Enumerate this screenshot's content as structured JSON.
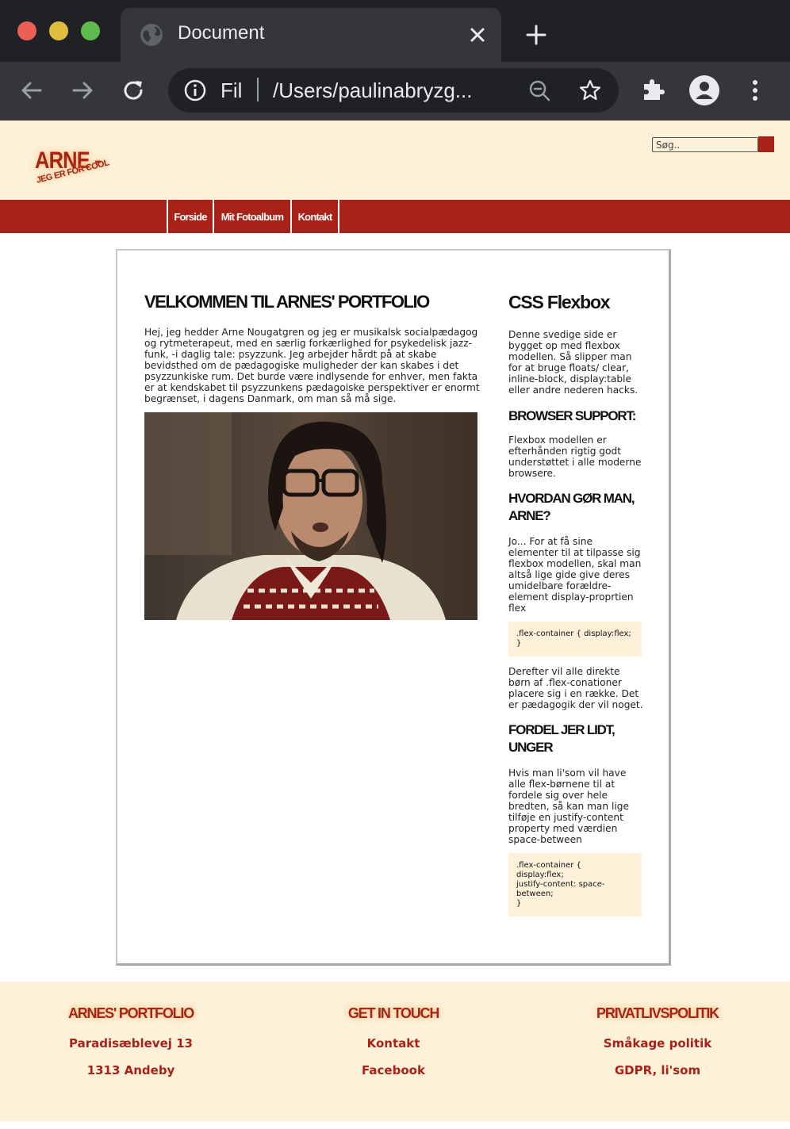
{
  "browser": {
    "tab_title": "Document",
    "omnibox_prefix": "Fil",
    "url": "/Users/paulinabryzg..."
  },
  "header": {
    "logo_main": "ARNE -",
    "logo_sub": "JEG ER FOR COOL",
    "search_placeholder": "Søg.."
  },
  "nav": {
    "items": [
      "Forside",
      "Mit Fotoalbum",
      "Kontakt"
    ]
  },
  "main": {
    "title": "VELKOMMEN TIL ARNES' PORTFOLIO",
    "text": "Hej, jeg hedder Arne Nougatgren og jeg er musikalsk socialpædagog og rytmeterapeut, med en særlig forkærlighed for psykedelisk jazz-funk, -i daglig tale: psyzzunk. Jeg arbejder hårdt på at skabe bevidsthed om de pædagogiske muligheder der kan skabes i det psyzzunkiske rum. Det burde være indlysende for enhver, men fakta er at kendskabet til psyzzunkens pædagoiske perspektiver er enormt begrænset, i dagens Danmark, om man så må sige."
  },
  "sidebar": {
    "h1": "CSS Flexbox",
    "p1": "Denne svedige side er bygget op med flexbox modellen. Så slipper man for at bruge floats/ clear, inline-block, display:table eller andre nederen hacks.",
    "h2": "BROWSER SUPPORT:",
    "p2": "Flexbox modellen er efterhånden rigtig godt understøttet i alle moderne browsere.",
    "h3": "HVORDAN GØR MAN, ARNE?",
    "p3": "Jo... For at få sine elementer til at tilpasse sig flexbox modellen, skal man altså lige gide give deres umidelbare forældre-element display-proprtien flex",
    "code1": ".flex-container { display:flex;\n}",
    "p4": "Derefter vil alle direkte børn af .flex-conationer placere sig i en række. Det er pædagogik der vil noget.",
    "h4": "FORDEL JER LIDT, UNGER",
    "p5": "Hvis man li'som vil have alle flex-børnene til at fordele sig over hele bredten, så kan man lige tilføje en justify-content property med værdien space-between",
    "code2": ".flex-container {\ndisplay:flex;\njustify-content: space-between;\n}"
  },
  "footer": {
    "col1": {
      "heading": "ARNES' PORTFOLIO",
      "links": [
        "Paradisæblevej 13",
        "1313 Andeby"
      ]
    },
    "col2": {
      "heading": "GET IN TOUCH",
      "links": [
        "Kontakt",
        "Facebook"
      ]
    },
    "col3": {
      "heading": "PRIVATLIVSPOLITIK",
      "links": [
        "Småkage politik",
        "GDPR, li'som"
      ]
    }
  },
  "colors": {
    "accent": "#a82218",
    "cream": "#fdf1da",
    "chrome_dark": "#202124",
    "chrome_mid": "#35363a"
  }
}
